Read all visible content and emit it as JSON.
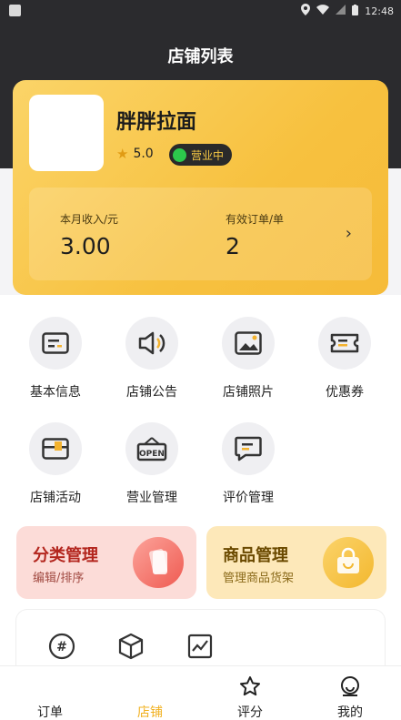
{
  "status_bar": {
    "time": "12:48"
  },
  "header": {
    "title": "店铺列表"
  },
  "shop": {
    "name": "胖胖拉面",
    "rating": "5.0",
    "status": "营业中",
    "stats": {
      "income_label": "本月收入/元",
      "income_value": "3.00",
      "orders_label": "有效订单/单",
      "orders_value": "2"
    }
  },
  "menu": [
    {
      "label": "基本信息",
      "icon": "info-card-icon"
    },
    {
      "label": "店铺公告",
      "icon": "speaker-icon"
    },
    {
      "label": "店铺照片",
      "icon": "picture-icon"
    },
    {
      "label": "优惠券",
      "icon": "coupon-icon"
    },
    {
      "label": "店铺活动",
      "icon": "activity-card-icon"
    },
    {
      "label": "营业管理",
      "icon": "open-sign-icon"
    },
    {
      "label": "评价管理",
      "icon": "comment-icon"
    }
  ],
  "management": {
    "category": {
      "title": "分类管理",
      "subtitle": "编辑/排序",
      "icon": "cards-icon"
    },
    "product": {
      "title": "商品管理",
      "subtitle": "管理商品货架",
      "icon": "shopping-bag-icon"
    }
  },
  "tabbar": [
    {
      "label": "订单",
      "icon": "order-icon"
    },
    {
      "label": "店铺",
      "icon": "shop-icon",
      "active": true
    },
    {
      "label": "评分",
      "icon": "star-outline-icon"
    },
    {
      "label": "我的",
      "icon": "profile-icon"
    }
  ],
  "colors": {
    "accent": "#f6bb39",
    "dark": "#2b2b2e",
    "active_tab": "#f1b01e"
  }
}
